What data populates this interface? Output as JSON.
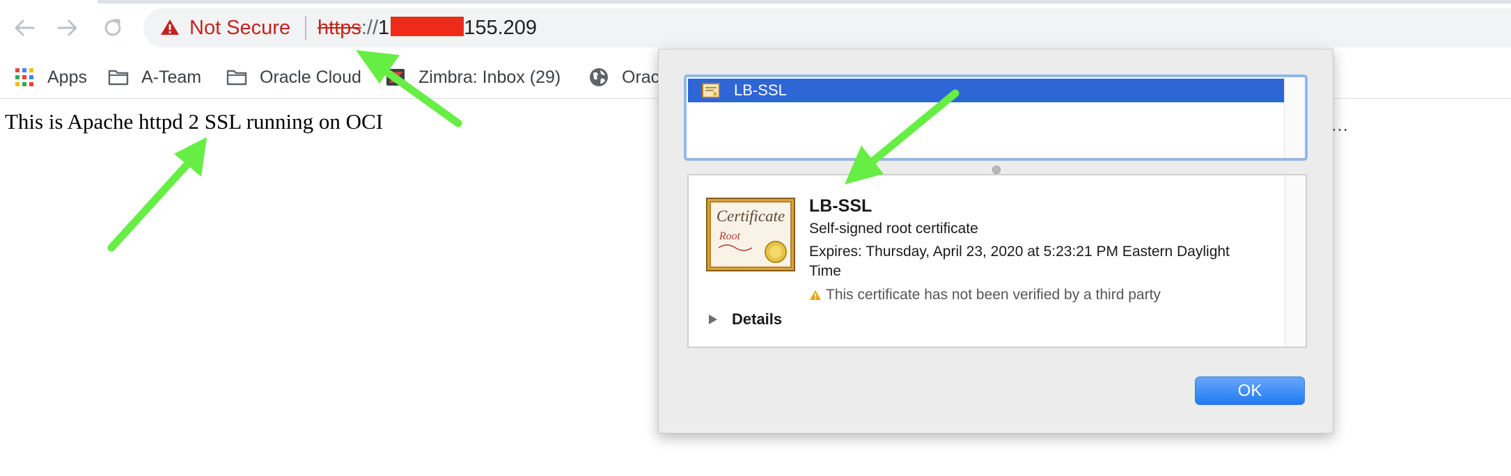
{
  "toolbar": {
    "back_icon": "arrow-left-icon",
    "forward_icon": "arrow-right-icon",
    "reload_icon": "reload-icon",
    "security_label": "Not Secure",
    "security_icon": "warning-triangle-icon",
    "url_scheme": "https",
    "url_separator": "://",
    "url_leading_char": "1",
    "url_host_tail": "155.209",
    "colors": {
      "insecure": "#c5221f",
      "redaction": "#ee2a1b"
    }
  },
  "bookmarks": {
    "items": [
      {
        "label": "Apps",
        "icon": "apps-grid-icon"
      },
      {
        "label": "A-Team",
        "icon": "folder-icon"
      },
      {
        "label": "Oracle Cloud",
        "icon": "folder-icon"
      },
      {
        "label": "Zimbra: Inbox (29)",
        "icon": "zimbra-icon"
      },
      {
        "label": "Orac",
        "icon": "globe-icon"
      }
    ],
    "overflow": "…"
  },
  "page": {
    "body_text": "This is Apache httpd 2 SSL running on OCI"
  },
  "dialog": {
    "list_item": "LB-SSL",
    "cert_name": "LB-SSL",
    "cert_type": "Self-signed root certificate",
    "expires": "Expires: Thursday, April 23, 2020 at 5:23:21 PM Eastern Daylight Time",
    "warning": "This certificate has not been verified by a third party",
    "details_label": "Details",
    "ok_label": "OK",
    "badge_title": "Certificate",
    "badge_subtitle": "Root",
    "colors": {
      "selection": "#2e66d6",
      "ok_button": "#1f7cf5",
      "warning": "#e8a617"
    }
  },
  "annotations": {
    "arrow_color": "#66ee44"
  }
}
